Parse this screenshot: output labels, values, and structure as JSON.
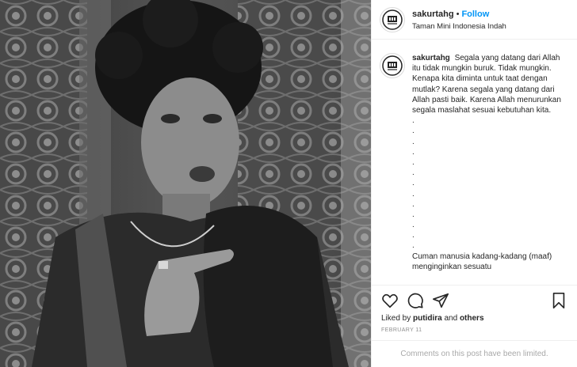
{
  "header": {
    "username": "sakurtahg",
    "separator": "•",
    "follow_label": "Follow",
    "location": "Taman Mini Indonesia Indah"
  },
  "caption": {
    "username": "sakurtahg",
    "text": "Segala yang datang dari Allah itu tidak mungkin buruk. Tidak mungkin. Kenapa kita diminta untuk taat dengan mutlak? Karena segala yang datang dari Allah pasti baik. Karena Allah menurunkan segala maslahat sesuai kebutuhan kita.",
    "dots": [
      ".",
      ".",
      ".",
      ".",
      ".",
      ".",
      ".",
      ".",
      ".",
      ".",
      ".",
      ".",
      "."
    ],
    "continued": "Cuman manusia kadang-kadang (maaf) menginginkan sesuatu"
  },
  "actions": {
    "icons": [
      "heart-icon",
      "comment-icon",
      "share-icon",
      "bookmark-icon"
    ]
  },
  "likes": {
    "prefix": "Liked by",
    "user": "putidira",
    "middle": "and",
    "others": "others"
  },
  "date": "FEBRUARY 11",
  "limited_text": "Comments on this post have been limited.",
  "colors": {
    "accent": "#0095f6",
    "text": "#262626",
    "muted": "#8e8e8e",
    "border": "#efefef"
  }
}
